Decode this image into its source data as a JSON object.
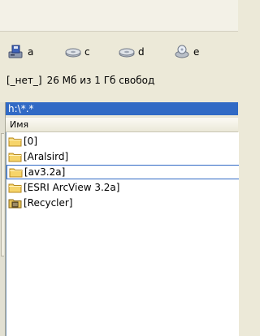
{
  "toolbar": {
    "drives": [
      {
        "letter": "a",
        "icon": "floppy-drive-icon"
      },
      {
        "letter": "c",
        "icon": "hard-drive-icon"
      },
      {
        "letter": "d",
        "icon": "hard-drive-icon"
      },
      {
        "letter": "e",
        "icon": "cd-drive-icon"
      }
    ]
  },
  "drive_info": {
    "volume_label": "[_нет_]",
    "free_space_text": "26 Мб из 1 Гб свобод"
  },
  "panel": {
    "path": "h:\\*.*",
    "column_name": "Имя",
    "files": [
      {
        "name": "[0]",
        "icon": "folder-icon"
      },
      {
        "name": "[Aralsird]",
        "icon": "folder-icon"
      },
      {
        "name": "[av3.2a]",
        "icon": "folder-icon",
        "focused": true
      },
      {
        "name": "[ESRI ArcView 3.2a]",
        "icon": "folder-icon"
      },
      {
        "name": "[Recycler]",
        "icon": "recycle-folder-icon"
      }
    ]
  },
  "colors": {
    "path_bar": "#316ac5",
    "background": "#ece9d8",
    "folder": "#f6d46a"
  }
}
